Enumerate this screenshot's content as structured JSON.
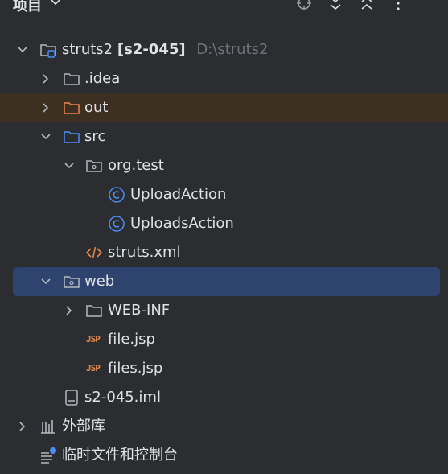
{
  "header": {
    "title": "项目"
  },
  "tree": {
    "root": {
      "name": "struts2",
      "module": "[s2-045]",
      "path": "D:\\struts2"
    },
    "idea": ".idea",
    "out": "out",
    "src": "src",
    "package": "org.test",
    "class1": "UploadAction",
    "class2": "UploadsAction",
    "struts_xml": "struts.xml",
    "web": "web",
    "web_inf": "WEB-INF",
    "file_jsp": "file.jsp",
    "files_jsp": "files.jsp",
    "iml": "s2-045.iml",
    "ext_libs": "外部库",
    "scratches": "临时文件和控制台",
    "jsp_badge": "JSP"
  }
}
